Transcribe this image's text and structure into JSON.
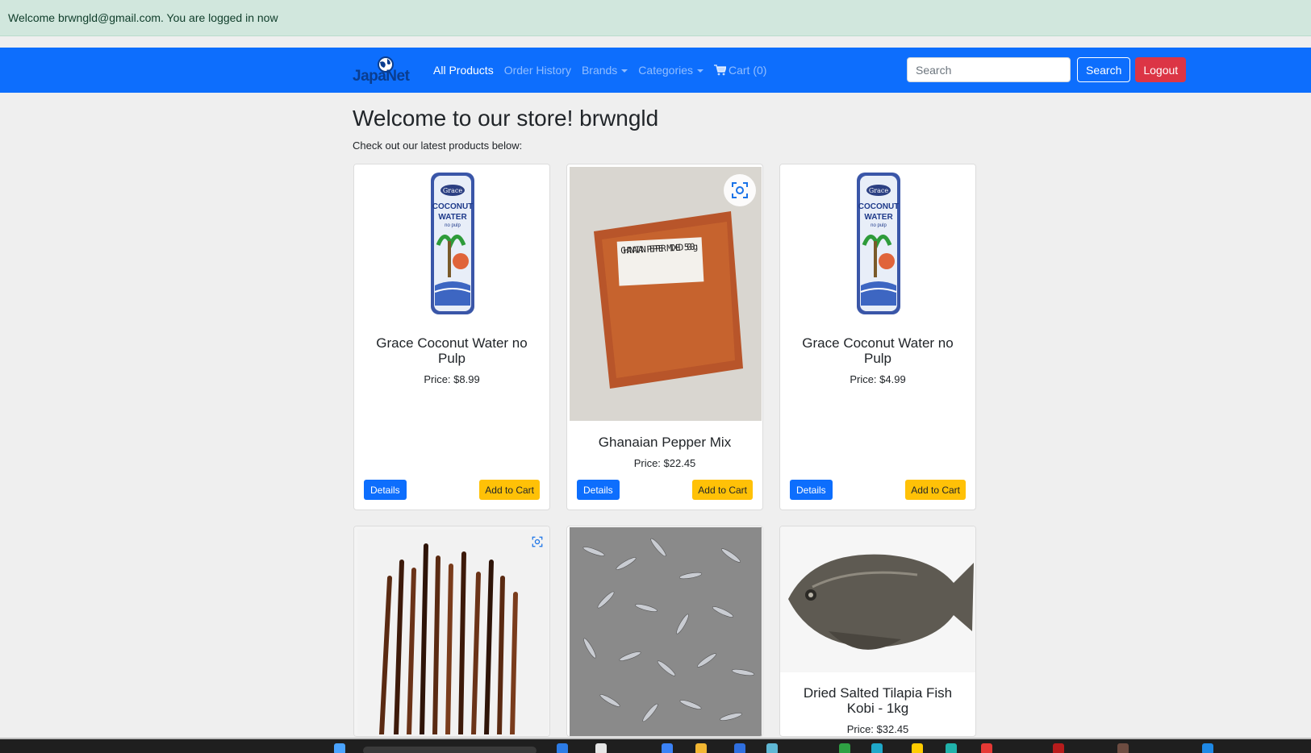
{
  "alert": {
    "text": "Welcome brwngld@gmail.com. You are logged in now"
  },
  "nav": {
    "brand": "JapaNet",
    "links": {
      "all_products": "All Products",
      "order_history": "Order History",
      "brands": "Brands",
      "categories": "Categories",
      "cart": "Cart (0)"
    },
    "search": {
      "placeholder": "Search",
      "value": ""
    },
    "search_button": "Search",
    "logout_button": "Logout"
  },
  "page": {
    "title": "Welcome to our store! brwngld",
    "subtitle": "Check out our latest products below:"
  },
  "products": [
    {
      "name": "Grace Coconut Water no Pulp",
      "price": "Price: $8.99",
      "details": "Details",
      "add": "Add to Cart"
    },
    {
      "name": "Ghanaian Pepper Mix",
      "price": "Price: $22.45",
      "details": "Details",
      "add": "Add to Cart",
      "label": "GHANAIAN PEPPER MIXED 500g"
    },
    {
      "name": "Grace Coconut Water no Pulp",
      "price": "Price: $4.99",
      "details": "Details",
      "add": "Add to Cart"
    },
    {
      "name": "",
      "price": ""
    },
    {
      "name": "",
      "price": ""
    },
    {
      "name": "Dried Salted Tilapia Fish Kobi - 1kg",
      "price": "Price: $32.45"
    }
  ],
  "can_label": {
    "brand": "Grace",
    "line1": "COCONUT",
    "line2": "WATER",
    "line3": "no pulp"
  },
  "colors": {
    "primary": "#0d6efd",
    "danger": "#dc3545",
    "warning": "#ffc107",
    "alert_bg": "#d1e7dd"
  }
}
